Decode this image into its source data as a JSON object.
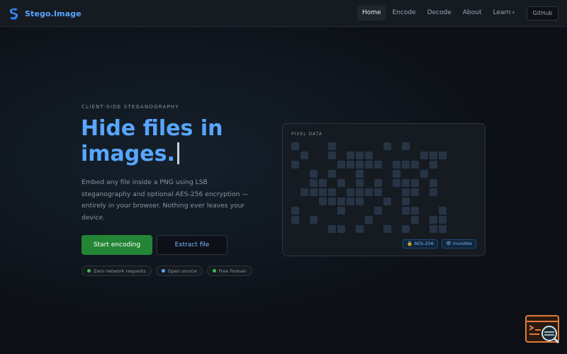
{
  "brand": {
    "name": "Stego.Image",
    "icon": "stego-logo-icon"
  },
  "nav": {
    "items": [
      {
        "label": "Home",
        "active": true
      },
      {
        "label": "Encode",
        "active": false
      },
      {
        "label": "Decode",
        "active": false
      },
      {
        "label": "About",
        "active": false
      },
      {
        "label": "Learn",
        "active": false,
        "has_dropdown": true
      }
    ],
    "learn_caret": "▾",
    "github_label": "GitHub"
  },
  "hero": {
    "eyebrow": "CLIENT-SIDE STEGANOGRAPHY",
    "title_line1": "Hide files in",
    "title_line2": "images.",
    "description": "Embed any file inside a PNG using LSB steganography and optional AES-256 encryption — entirely in your browser. Nothing ever leaves your device.",
    "primary_cta": "Start encoding",
    "secondary_cta": "Extract file",
    "pills": [
      {
        "label": "Zero network requests",
        "dot_color": "#3fb950"
      },
      {
        "label": "Open source",
        "dot_color": "#58a6ff"
      },
      {
        "label": "Free forever",
        "dot_color": "#3fb950"
      }
    ]
  },
  "pixel_card": {
    "label": "PIXEL DATA",
    "grid": [
      "X...X.....X.X...",
      ".X..X.XXX.....XXX",
      "X....XXXXX.XXX.X.",
      "..X.X..X...X..X..",
      "..XX.X.X.X.XXX.X.",
      ".XXXX.XXXX..XX.X.",
      "...XXXXX..X.X....",
      "X....X...X..XX..X",
      "X.X.....X....X.XX",
      "....XX.X..X.X..XX"
    ],
    "badges": [
      "🔒 AES-256",
      "👁 Invisible"
    ]
  },
  "colors": {
    "accent": "#58a6ff",
    "primary_button": "#238636",
    "background": "#0d1117",
    "cell": "#263445"
  },
  "corner_widget": {
    "icon": "terminal-search-icon"
  }
}
